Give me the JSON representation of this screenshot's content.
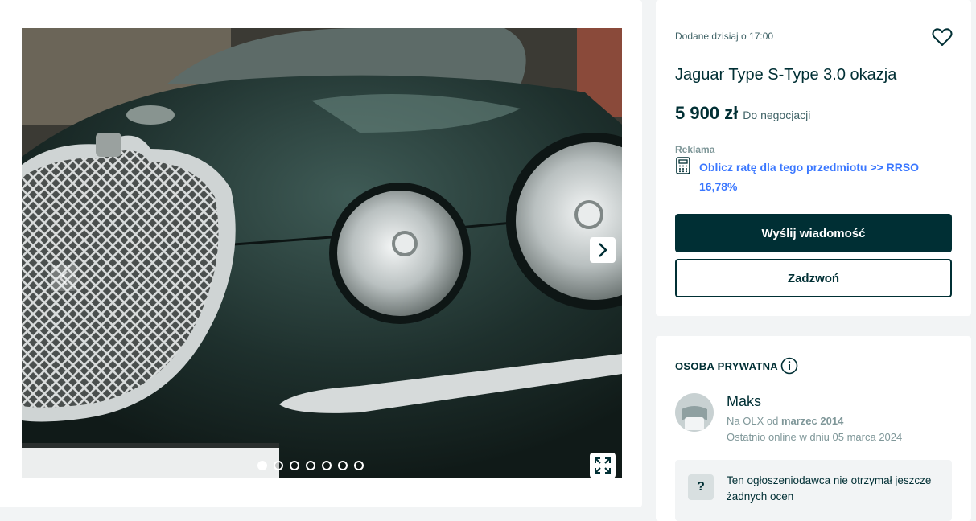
{
  "gallery": {
    "image_alt": "Jaguar Type S-Type 3.0 okazja",
    "photo_count": 7,
    "active_index": 0
  },
  "summary": {
    "posted": "Dodane dzisiaj o 17:00",
    "title": "Jaguar Type S-Type 3.0 okazja",
    "price": "5 900 zł",
    "negotiable": "Do negocjacji",
    "ad_label": "Reklama",
    "installment_link": "Oblicz ratę dla tego przedmiotu >> RRSO 16,78%",
    "message_button": "Wyślij wiadomość",
    "call_button": "Zadzwoń"
  },
  "seller": {
    "type": "OSOBA PRYWATNA",
    "name": "Maks",
    "since_prefix": "Na OLX od",
    "since_date": "marzec 2014",
    "last_online": "Ostatnio online w dniu 05 marca 2024",
    "rating_note": "Ten ogłoszeniodawca nie otrzymał jeszcze żadnych ocen",
    "rating_icon": "?"
  },
  "icons": {
    "favorite": "heart-icon",
    "calculator": "calculator-icon",
    "info": "info-icon",
    "expand": "expand-icon",
    "next": "chevron-right-icon",
    "prev": "chevron-left-icon"
  },
  "colors": {
    "primary": "#002f34",
    "link": "#3a77ff",
    "muted": "#7f9799",
    "background": "#f2f4f5"
  }
}
